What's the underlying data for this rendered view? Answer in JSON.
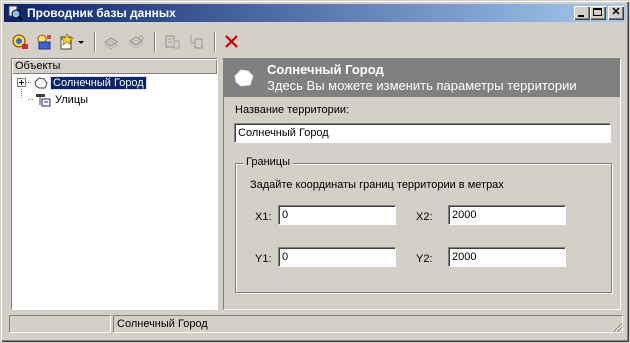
{
  "window": {
    "title": "Проводник базы данных",
    "controls": {
      "minimize": "_",
      "maximize": "□",
      "close": "✕"
    }
  },
  "toolbar": {
    "items": [
      {
        "name": "refresh-icon"
      },
      {
        "name": "new-object-icon"
      },
      {
        "name": "add-dropdown-icon"
      },
      {
        "name": "copy-disabled-icon"
      },
      {
        "name": "paste-disabled-icon"
      },
      {
        "name": "properties-disabled-icon"
      },
      {
        "name": "move-disabled-icon"
      },
      {
        "name": "delete-icon",
        "color": "#c00000"
      }
    ]
  },
  "tree": {
    "header": "Объекты",
    "nodes": [
      {
        "label": "Солнечный Город",
        "icon": "territory-icon",
        "selected": true,
        "expandable": true
      },
      {
        "label": "Улицы",
        "icon": "streets-icon",
        "selected": false,
        "expandable": false
      }
    ]
  },
  "detail": {
    "banner_title": "Солнечный Город",
    "banner_subtitle": "Здесь Вы можете изменить параметры территории",
    "name_label": "Название территории:",
    "name_value": "Солнечный Город",
    "bounds": {
      "group_title": "Границы",
      "hint": "Задайте координаты границ территории в метрах",
      "x1_label": "X1:",
      "x1_value": "0",
      "x2_label": "X2:",
      "x2_value": "2000",
      "y1_label": "Y1:",
      "y1_value": "0",
      "y2_label": "Y2:",
      "y2_value": "2000"
    }
  },
  "statusbar": {
    "cell1": "",
    "cell2": "Солнечный Город"
  },
  "colors": {
    "titlebar_start": "#0a246a",
    "titlebar_end": "#a6caf0",
    "banner": "#808080",
    "selection": "#0a246a",
    "face": "#d4d0c8"
  }
}
